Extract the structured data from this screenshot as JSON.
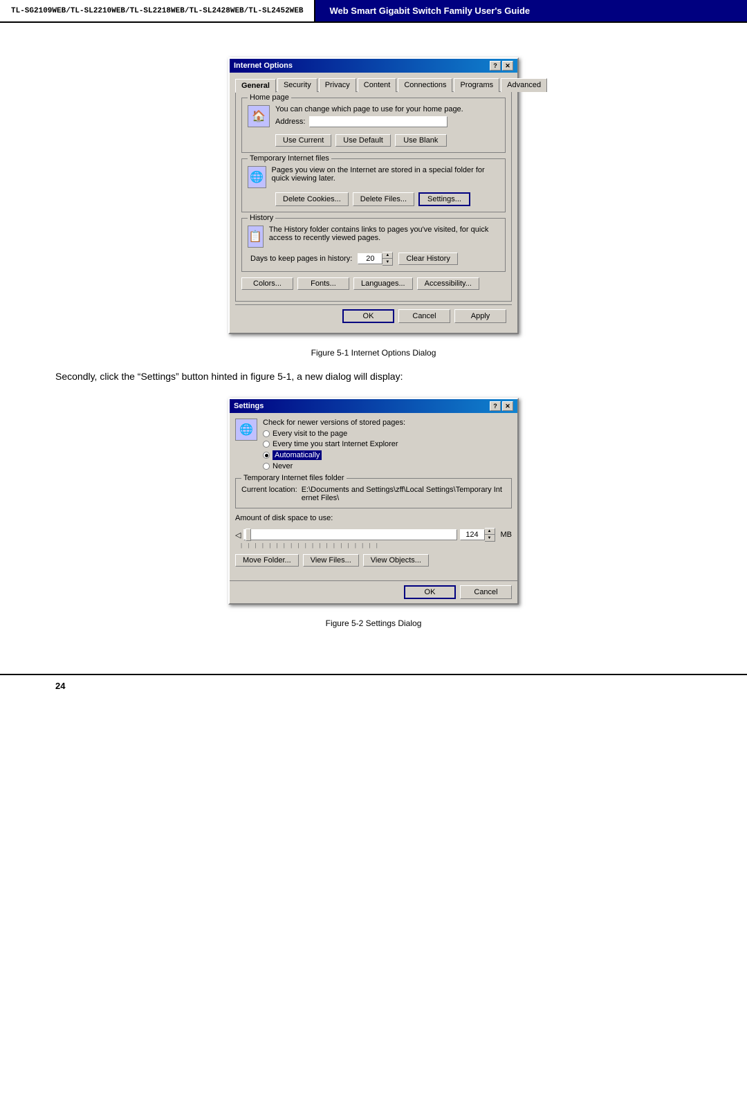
{
  "header": {
    "model_text": "TL-SG2109WEB/TL-SL2210WEB/TL-SL2218WEB/TL-SL2428WEB/TL-SL2452WEB",
    "guide_title": "Web Smart Gigabit Switch Family User's Guide"
  },
  "figure1": {
    "caption": "Figure 5-1  Internet Options Dialog",
    "dialog": {
      "title": "Internet Options",
      "tabs": [
        "General",
        "Security",
        "Privacy",
        "Content",
        "Connections",
        "Programs",
        "Advanced"
      ],
      "active_tab": "General",
      "home_page_section": {
        "title": "Home page",
        "desc": "You can change which page to use for your home page.",
        "address_label": "Address:",
        "address_value": "",
        "btn_use_current": "Use Current",
        "btn_use_default": "Use Default",
        "btn_use_blank": "Use Blank"
      },
      "temp_files_section": {
        "title": "Temporary Internet files",
        "desc": "Pages you view on the Internet are stored in a special folder for quick viewing later.",
        "btn_delete_cookies": "Delete Cookies...",
        "btn_delete_files": "Delete Files...",
        "btn_settings": "Settings..."
      },
      "history_section": {
        "title": "History",
        "desc": "The History folder contains links to pages you've visited, for quick access to recently viewed pages.",
        "days_label": "Days to keep pages in history:",
        "days_value": "20",
        "btn_clear": "Clear History"
      },
      "bottom_buttons": [
        "Colors...",
        "Fonts...",
        "Languages...",
        "Accessibility..."
      ],
      "dialog_buttons": {
        "ok": "OK",
        "cancel": "Cancel",
        "apply": "Apply"
      }
    }
  },
  "body_text": "Secondly, click the “Settings” button hinted in figure 5-1, a new dialog will display:",
  "figure2": {
    "caption": "Figure 5-2  Settings Dialog",
    "dialog": {
      "title": "Settings",
      "check_newer_label": "Check for newer versions of stored pages:",
      "radio_options": [
        {
          "label": "Every visit to the page",
          "selected": false
        },
        {
          "label": "Every time you start Internet Explorer",
          "selected": false
        },
        {
          "label": "Automatically",
          "selected": true
        },
        {
          "label": "Never",
          "selected": false
        }
      ],
      "temp_folder_section": {
        "title": "Temporary Internet files folder",
        "current_location_label": "Current location:",
        "current_location_value": "E:\\Documents and Settings\\zff\\Local Settings\\Temporary Internet Files\\"
      },
      "disk_space_label": "Amount of disk space to use:",
      "disk_value": "124",
      "disk_unit": "MB",
      "bottom_buttons": {
        "move_folder": "Move Folder...",
        "view_files": "View Files...",
        "view_objects": "View Objects..."
      },
      "dialog_buttons": {
        "ok": "OK",
        "cancel": "Cancel"
      }
    }
  },
  "footer": {
    "page_number": "24"
  }
}
